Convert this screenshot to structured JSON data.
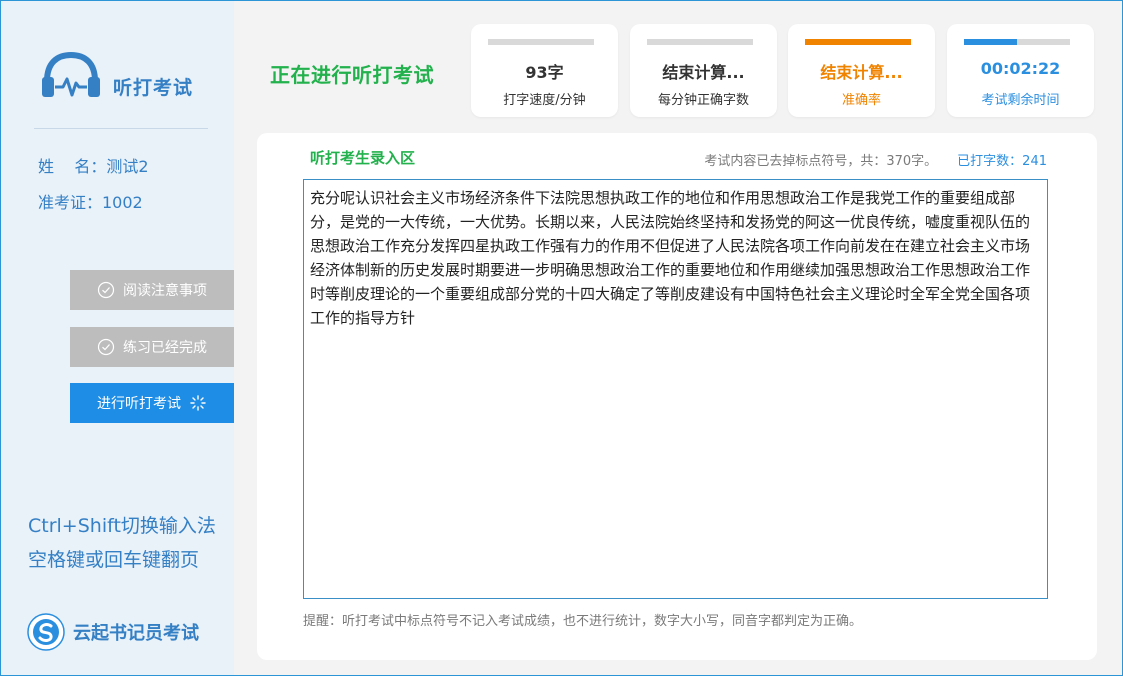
{
  "app": {
    "logo_text": "听打考试",
    "brand_text": "云起书记员考试"
  },
  "user": {
    "name_line": "姓    名：测试2",
    "id_line": "准考证：1002"
  },
  "steps": [
    {
      "label": "阅读注意事项",
      "state": "done"
    },
    {
      "label": "练习已经完成",
      "state": "done"
    },
    {
      "label": "进行听打考试",
      "state": "active"
    }
  ],
  "tips": {
    "line1": "Ctrl+Shift切换输入法",
    "line2": "空格键或回车键翻页"
  },
  "header": {
    "title": "正在进行听打考试"
  },
  "stats": [
    {
      "value": "93字",
      "label": "打字速度/分钟",
      "progress": 0,
      "color": "#333333"
    },
    {
      "value": "结束计算...",
      "label": "每分钟正确字数",
      "progress": 0,
      "color": "#333333"
    },
    {
      "value": "结束计算...",
      "label": "准确率",
      "progress": 1.0,
      "color": "#f08300"
    },
    {
      "value": "00:02:22",
      "label": "考试剩余时间",
      "progress": 0.5,
      "color": "#2b8fe0"
    }
  ],
  "panel": {
    "title": "听打考生录入区",
    "content_info": "考试内容已去掉标点符号，共：370字。",
    "typed_count": "已打字数：241",
    "editor_text": "充分呢认识社会主义市场经济条件下法院思想执政工作的地位和作用思想政治工作是我党工作的重要组成部分，是党的一大传统，一大优势。长期以来，人民法院始终坚持和发扬党的阿这一优良传统，嘘度重视队伍的思想政治工作充分发挥四星执政工作强有力的作用不但促进了人民法院各项工作向前发在在建立社会主义市场经济体制新的历史发展时期要进一步明确思想政治工作的重要地位和作用继续加强思想政治工作思想政治工作时等削皮理论的一个重要组成部分党的十四大确定了等削皮建设有中国特色社会主义理论时全军全党全国各项工作的指导方针",
    "reminder": "提醒：听打考试中标点符号不记入考试成绩，也不进行统计，数字大小写，同音字都判定为正确。"
  },
  "colors": {
    "accent_blue": "#1e8de5",
    "title_green": "#22b14c",
    "orange": "#f08300",
    "done_gray": "#bdbdbd"
  }
}
